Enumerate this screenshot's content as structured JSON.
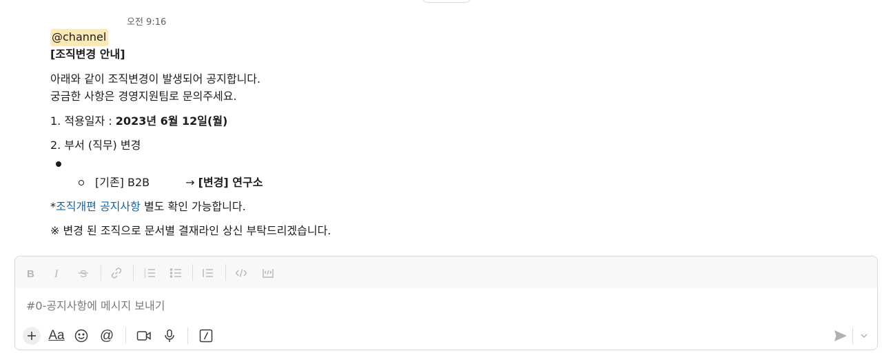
{
  "message": {
    "time": "오전 9:16",
    "mention": "@channel",
    "title": "[조직변경 안내]",
    "intro_1": "아래와 같이 조직변경이 발생되어 공지합니다.",
    "intro_2": "궁금한 사항은 경영지원팀로 문의주세요.",
    "item1_label": "1. 적용일자 : ",
    "item1_value": "2023년 6월 12일(월)",
    "item2_label": "2. 부서 (직무) 변경",
    "change_before": "[기존] B2B",
    "change_arrow": "→ ",
    "change_after": "[변경] 연구소",
    "note_prefix": "*",
    "note_link": "조직개편 공지사항",
    "note_suffix": " 별도 확인 가능합니다.",
    "closing": "※ 변경 된 조직으로 문서별 결재라인 상신 부탁드리겠습니다."
  },
  "composer": {
    "placeholder": "#0-공지사항에 메시지 보내기",
    "format_tools": [
      "bold-icon",
      "italic-icon",
      "strikethrough-icon",
      "link-icon",
      "ordered-list-icon",
      "bulleted-list-icon",
      "blockquote-icon",
      "code-icon",
      "code-block-icon"
    ],
    "bottom_tools": [
      "plus-icon",
      "text-format-icon",
      "emoji-icon",
      "mention-icon",
      "video-icon",
      "microphone-icon",
      "slash-command-icon"
    ],
    "text_format_label": "Aa",
    "mention_symbol": "@"
  }
}
